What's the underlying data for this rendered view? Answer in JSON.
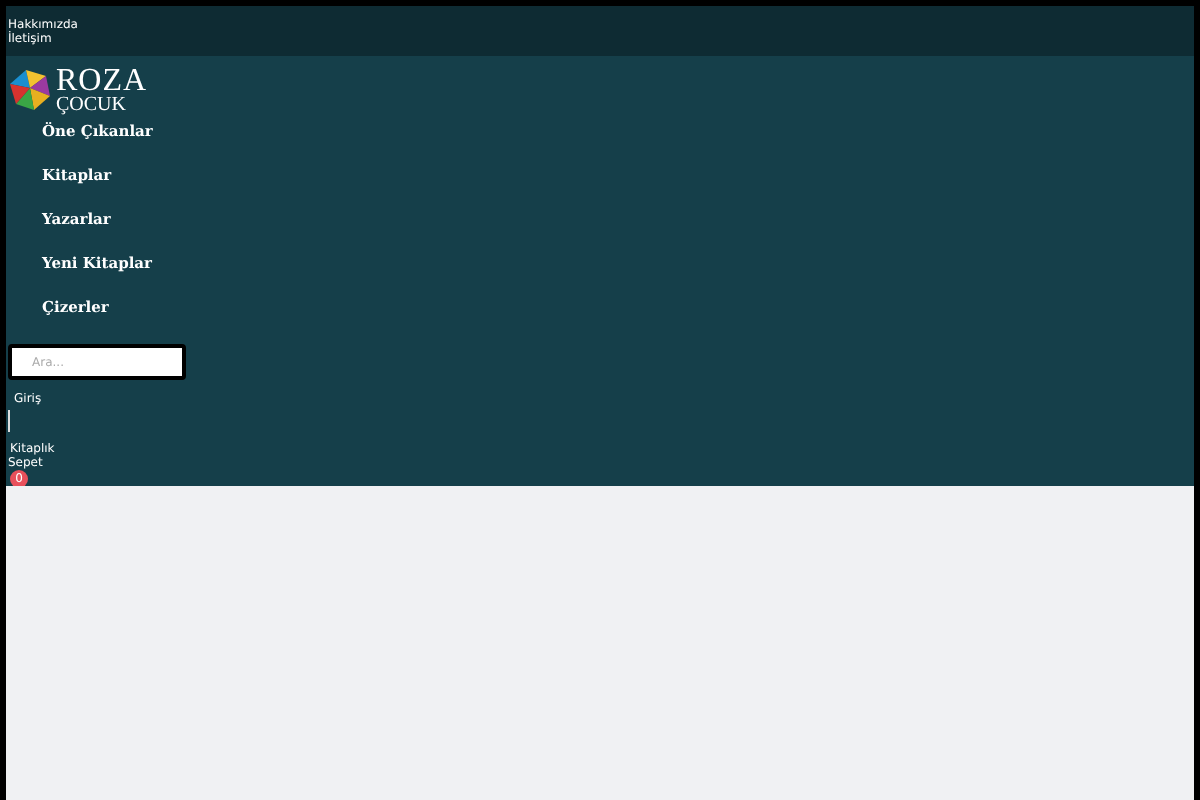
{
  "top_links": [
    "Hakkımızda",
    "İletişim"
  ],
  "logo": {
    "line_1": "ROZA",
    "line_2": "ÇOCUK"
  },
  "nav": [
    "Öne Çıkanlar",
    "Kitaplar",
    "Yazarlar",
    "Yeni Kitaplar",
    "Çizerler"
  ],
  "search": {
    "placeholder": "Ara..."
  },
  "account": {
    "login": "Giriş",
    "library": "Kitaplık",
    "cart": "Sepet",
    "cart_count": "0"
  }
}
